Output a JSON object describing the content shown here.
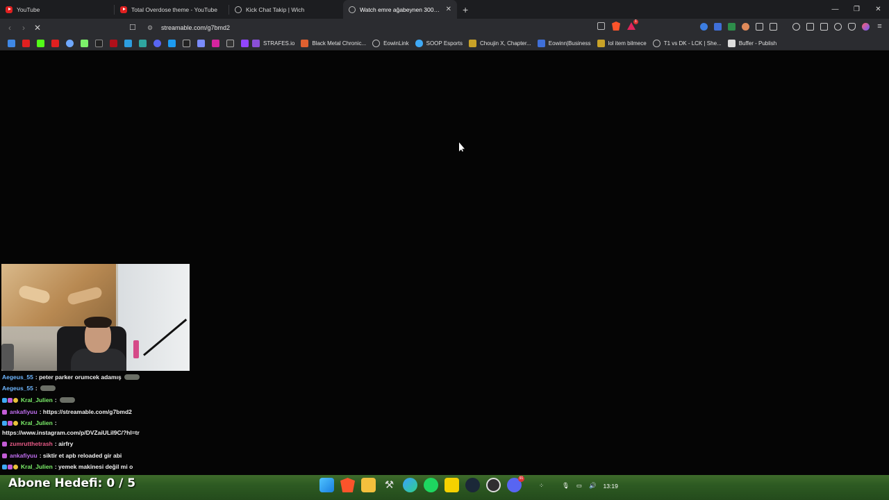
{
  "tabs": [
    {
      "title": "YouTube",
      "favicon": "youtube-icon",
      "active": false
    },
    {
      "title": "Total Overdose theme - YouTube",
      "favicon": "youtube-icon",
      "active": false
    },
    {
      "title": "Kick Chat Takip | Wich",
      "favicon": "globe-icon",
      "active": false
    },
    {
      "title": "Watch emre ağabeynen 300+ ka",
      "favicon": "globe-icon",
      "active": true
    }
  ],
  "window_controls": {
    "minimize": "—",
    "restore": "❐",
    "close": "✕"
  },
  "toolbar": {
    "back": "‹",
    "forward": "›",
    "reload": "✕",
    "url": "streamable.com/g7bmd2",
    "brave_badge": "1"
  },
  "bookmarks": [
    {
      "label": "STRAFES.io",
      "color": "#8a4fd8"
    },
    {
      "label": "Black Metal Chronic...",
      "color": "#e06030"
    },
    {
      "label": "EowinLink",
      "color": "#bbbbbb"
    },
    {
      "label": "SOOP Esports",
      "color": "#3fa9f5"
    },
    {
      "label": "Choujin X, Chapter...",
      "color": "#c9a227"
    },
    {
      "label": "Eowinn|Business",
      "color": "#3f6fd8"
    },
    {
      "label": "lol item bilmece",
      "color": "#c9a227"
    },
    {
      "label": "T1 vs DK - LCK | She...",
      "color": "#bbbbbb"
    },
    {
      "label": "Buffer - Publish",
      "color": "#dddddd"
    }
  ],
  "chat": [
    {
      "user": "Aegeus_55",
      "color": "#6fb7ff",
      "message": ": peter parker orumcek adamış",
      "emote": true,
      "badges": []
    },
    {
      "user": "Aegeus_55",
      "color": "#6fb7ff",
      "message": ":",
      "emote": true,
      "badges": []
    },
    {
      "user": "Kral_Julien",
      "color": "#7cf06a",
      "message": ":",
      "emote": true,
      "badges": [
        "#3fa9f5",
        "#c35cd6",
        "#e8c13a"
      ]
    },
    {
      "user": "ankafiyuu",
      "color": "#c06ef0",
      "message": ": https://streamable.com/g7bmd2",
      "emote": false,
      "badges": [
        "#c35cd6"
      ]
    },
    {
      "user": "Kral_Julien",
      "color": "#7cf06a",
      "message": ":",
      "emote": false,
      "badges": [
        "#3fa9f5",
        "#c35cd6",
        "#e8c13a"
      ]
    },
    {
      "user": "",
      "color": "#ffffff",
      "message": "https://www.instagram.com/p/DVZaiULiI9C/?hl=tr",
      "emote": false,
      "badges": []
    },
    {
      "user": "zumrutthetrash",
      "color": "#e85a86",
      "message": ": airfry",
      "emote": false,
      "badges": [
        "#c35cd6"
      ]
    },
    {
      "user": "ankafiyuu",
      "color": "#c06ef0",
      "message": ": siktir et apb reloaded gir abi",
      "emote": false,
      "badges": [
        "#c35cd6"
      ]
    },
    {
      "user": "Kral_Julien",
      "color": "#7cf06a",
      "message": ": yemek makinesi değil mi o",
      "emote": false,
      "badges": [
        "#3fa9f5",
        "#c35cd6",
        "#e8c13a"
      ]
    }
  ],
  "overlay": {
    "subscriber_goal": "Abone Hedefi:  0 / 5"
  },
  "taskbar": {
    "clock": "13:19",
    "discord_badge": "91"
  }
}
